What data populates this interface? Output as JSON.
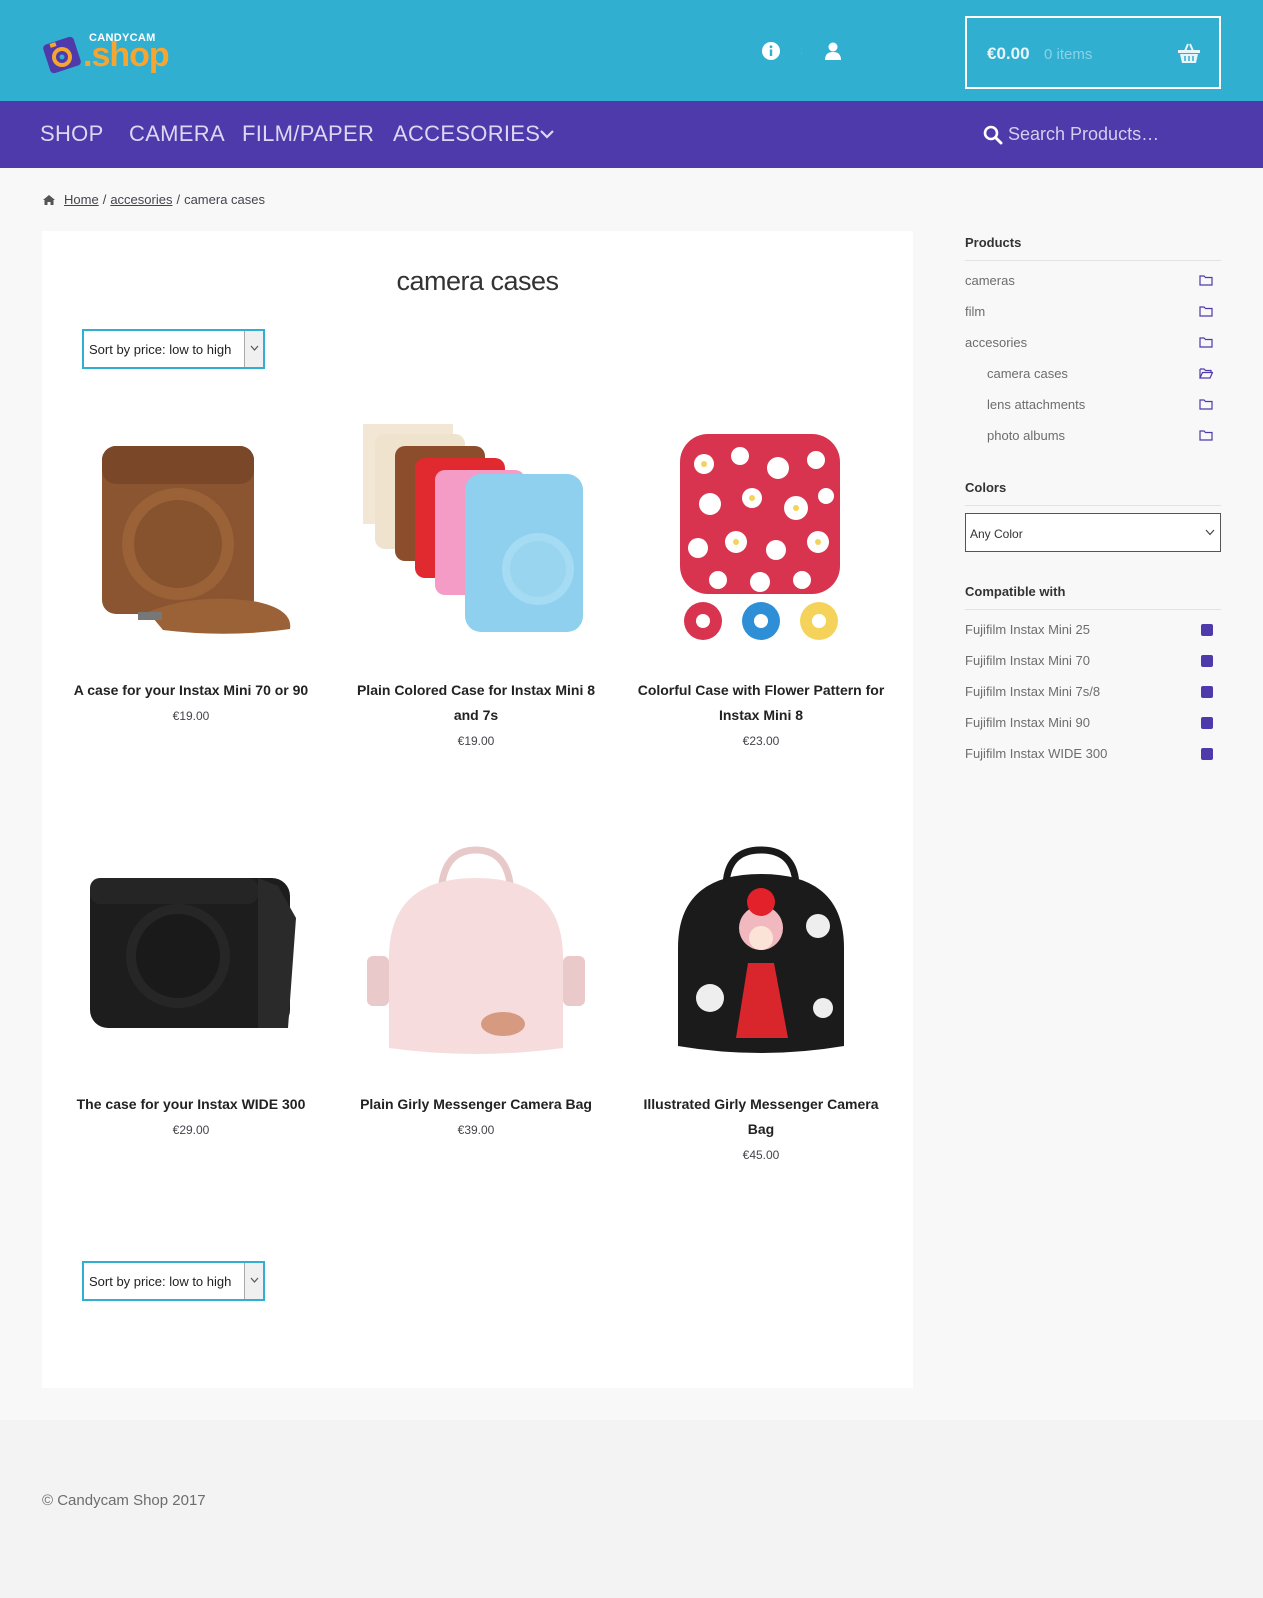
{
  "header": {
    "logo_small": "CANDYCAM",
    "logo_big": ".shop",
    "cart_amount": "€0.00",
    "cart_items": "0 items",
    "separator": ":"
  },
  "nav": {
    "items": [
      "SHOP",
      "CAMERA",
      "FILM/PAPER",
      "ACCESORIES"
    ],
    "search_placeholder": "Search Products…"
  },
  "breadcrumb": {
    "home": "Home",
    "sep1": "/",
    "category": "accesories",
    "sep2": "/",
    "current": "camera cases"
  },
  "main": {
    "title": "camera cases",
    "sort_label": "Sort by price: low to high",
    "products": [
      {
        "name": "A case for your Instax Mini 70 or 90",
        "price": "€19.00"
      },
      {
        "name": "Plain Colored Case for Instax Mini 8 and 7s",
        "price": "€19.00"
      },
      {
        "name": "Colorful Case with Flower Pattern for Instax Mini 8",
        "price": "€23.00"
      },
      {
        "name": "The case for your Instax WIDE 300",
        "price": "€29.00"
      },
      {
        "name": "Plain Girly Messenger Camera Bag",
        "price": "€39.00"
      },
      {
        "name": "Illustrated Girly Messenger Camera Bag",
        "price": "€45.00"
      }
    ]
  },
  "sidebar": {
    "products_heading": "Products",
    "categories": [
      "cameras",
      "film",
      "accesories"
    ],
    "subcategories": [
      "camera cases",
      "lens attachments",
      "photo albums"
    ],
    "colors_heading": "Colors",
    "color_select": "Any Color",
    "compatible_heading": "Compatible with",
    "compatible": [
      "Fujifilm Instax Mini 25",
      "Fujifilm Instax Mini 70",
      "Fujifilm Instax Mini 7s/8",
      "Fujifilm Instax Mini 90",
      "Fujifilm Instax WIDE 300"
    ]
  },
  "footer": {
    "copyright": "© Candycam Shop 2017"
  },
  "colors": {
    "header": "#31afd0",
    "nav": "#4e3aaa",
    "accent_logo": "#f7a531",
    "swatch": "#4e3aaa"
  },
  "icons": {
    "info": "info-icon",
    "account": "user-icon",
    "cart": "basket-icon",
    "search": "search-icon",
    "home": "home-icon",
    "folder": "folder-icon",
    "folder_open": "folder-open-icon",
    "chevron": "chevron-down-icon"
  }
}
